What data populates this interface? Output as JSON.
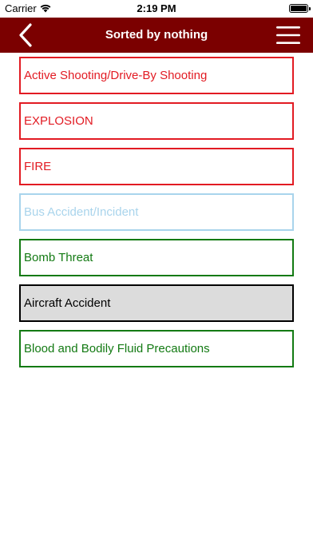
{
  "status_bar": {
    "carrier": "Carrier",
    "time": "2:19 PM",
    "battery_level": 1.0
  },
  "nav": {
    "title": "Sorted by nothing",
    "back_icon": "chevron-left-icon",
    "menu_icon": "hamburger-menu-icon",
    "background_color": "#7b0000"
  },
  "items": [
    {
      "label": "Active Shooting/Drive-By Shooting",
      "border": "#e21b23",
      "color": "#e21b23",
      "background": "#ffffff"
    },
    {
      "label": "EXPLOSION",
      "border": "#e21b23",
      "color": "#e21b23",
      "background": "#ffffff"
    },
    {
      "label": "FIRE",
      "border": "#e21b23",
      "color": "#e21b23",
      "background": "#ffffff"
    },
    {
      "label": "Bus Accident/Incident",
      "border": "#a9d4ec",
      "color": "#a9d4ec",
      "background": "#ffffff"
    },
    {
      "label": "Bomb Threat",
      "border": "#137a13",
      "color": "#137a13",
      "background": "#ffffff"
    },
    {
      "label": "Aircraft Accident",
      "border": "#000000",
      "color": "#000000",
      "background": "#dcdcdc"
    },
    {
      "label": "Blood and Bodily Fluid Precautions",
      "border": "#137a13",
      "color": "#137a13",
      "background": "#ffffff"
    }
  ]
}
